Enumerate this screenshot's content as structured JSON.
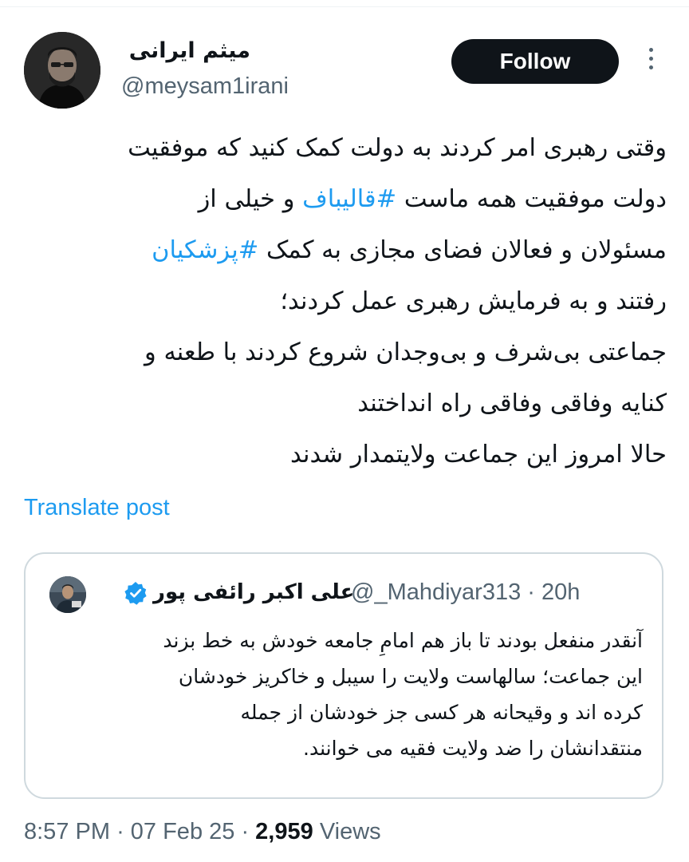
{
  "author": {
    "display_name": "میثم ایرانی",
    "handle": "@meysam1irani"
  },
  "follow_label": "Follow",
  "tweet": {
    "lines": [
      [
        {
          "t": "وقتی رهبری امر کردند به دولت کمک کنید که موفقیت"
        }
      ],
      [
        {
          "t": "دولت موفقیت همه ماست "
        },
        {
          "t": "#قالیباف",
          "tag": true
        },
        {
          "t": " و خیلی از"
        }
      ],
      [
        {
          "t": "مسئولان و فعالان فضای مجازی به کمک "
        },
        {
          "t": "#پزشکیان",
          "tag": true
        }
      ],
      [
        {
          "t": "رفتند و به فرمایش رهبری عمل کردند؛"
        }
      ],
      [
        {
          "t": "جماعتی بی‌شرف و بی‌وجدان شروع کردند با طعنه و"
        }
      ],
      [
        {
          "t": "کنایه وفاقی وفاقی راه انداختند"
        }
      ],
      [
        {
          "t": "حالا امروز این جماعت ولایتمدار شدند"
        }
      ]
    ],
    "translate_label": "Translate post"
  },
  "quote": {
    "name": "علی اکبر رائفی پور",
    "handle_time": "@_Mahdiyar313 · 20h",
    "lines": [
      "آنقدر منفعل بودند تا باز هم امامِ جامعه خودش به خط بزند",
      "این جماعت؛ سالهاست ولایت را سیبل و خاکریز خودشان",
      "کرده اند و وقیحانه هر کسی جز خودشان از جمله",
      "منتقدانشان را ضد ولایت فقیه می خوانند."
    ]
  },
  "meta": {
    "time": "8:57 PM",
    "date": "07 Feb 25",
    "views_count": "2,959",
    "views_label": "Views"
  },
  "colors": {
    "link": "#1d9bf0",
    "text": "#0f1419",
    "muted": "#536471",
    "border": "#cfd9de"
  }
}
